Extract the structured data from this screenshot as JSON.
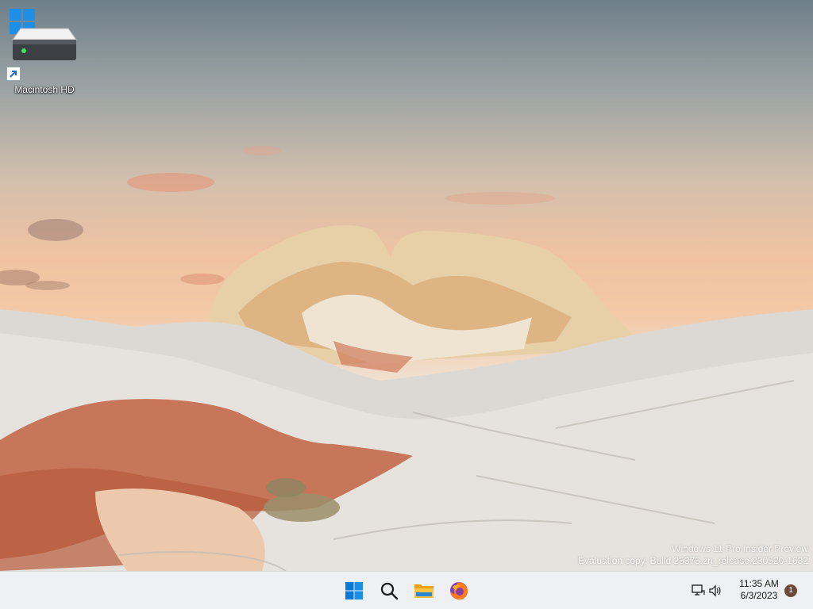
{
  "desktop": {
    "icons": [
      {
        "label": "Macintosh HD",
        "icon": "hard-drive-icon"
      }
    ],
    "watermark": {
      "line1": "Windows 11 Pro Insider Preview",
      "line2": "Evaluation copy. Build 25375.zn_release.230520-1632"
    }
  },
  "taskbar": {
    "apps": [
      {
        "name": "Start",
        "icon": "windows-start-icon"
      },
      {
        "name": "Search",
        "icon": "search-icon"
      },
      {
        "name": "File Explorer",
        "icon": "folder-icon"
      },
      {
        "name": "Firefox",
        "icon": "firefox-icon"
      }
    ],
    "tray": {
      "network_icon": "network-icon",
      "volume_icon": "volume-icon",
      "time": "11:35 AM",
      "date": "6/3/2023",
      "notification_count": "1"
    },
    "colors": {
      "background": "#eef0f3",
      "windows_blue": "#0a7ad8",
      "folder_yellow": "#f6c343",
      "badge": "#6b4a3a"
    }
  }
}
